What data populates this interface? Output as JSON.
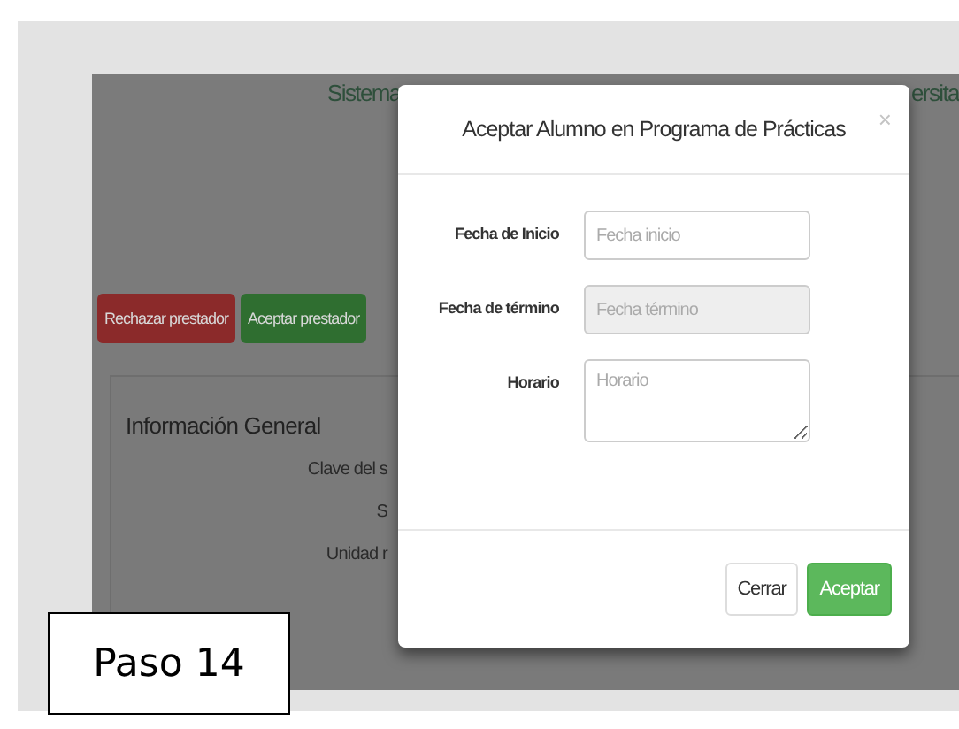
{
  "page": {
    "title_left": "Sistema",
    "title_right": "ersita",
    "actions": [
      {
        "label": "Rechazar prestador",
        "kind": "danger"
      },
      {
        "label": "Aceptar prestador",
        "kind": "success"
      }
    ],
    "panel": {
      "heading": "Información General",
      "labels": [
        "Clave del s",
        "S",
        "Unidad r"
      ]
    }
  },
  "modal": {
    "title": "Aceptar Alumno en Programa de Prácticas",
    "close": "×",
    "fields": [
      {
        "label": "Fecha de Inicio",
        "placeholder": "Fecha inicio",
        "kind": "input",
        "disabled": false
      },
      {
        "label": "Fecha de término",
        "placeholder": "Fecha término",
        "kind": "input",
        "disabled": true
      },
      {
        "label": "Horario",
        "placeholder": "Horario",
        "kind": "textarea",
        "disabled": false
      }
    ],
    "buttons": [
      {
        "label": "Cerrar",
        "kind": "default"
      },
      {
        "label": "Aceptar",
        "kind": "success"
      }
    ]
  },
  "step_label": "Paso 14"
}
